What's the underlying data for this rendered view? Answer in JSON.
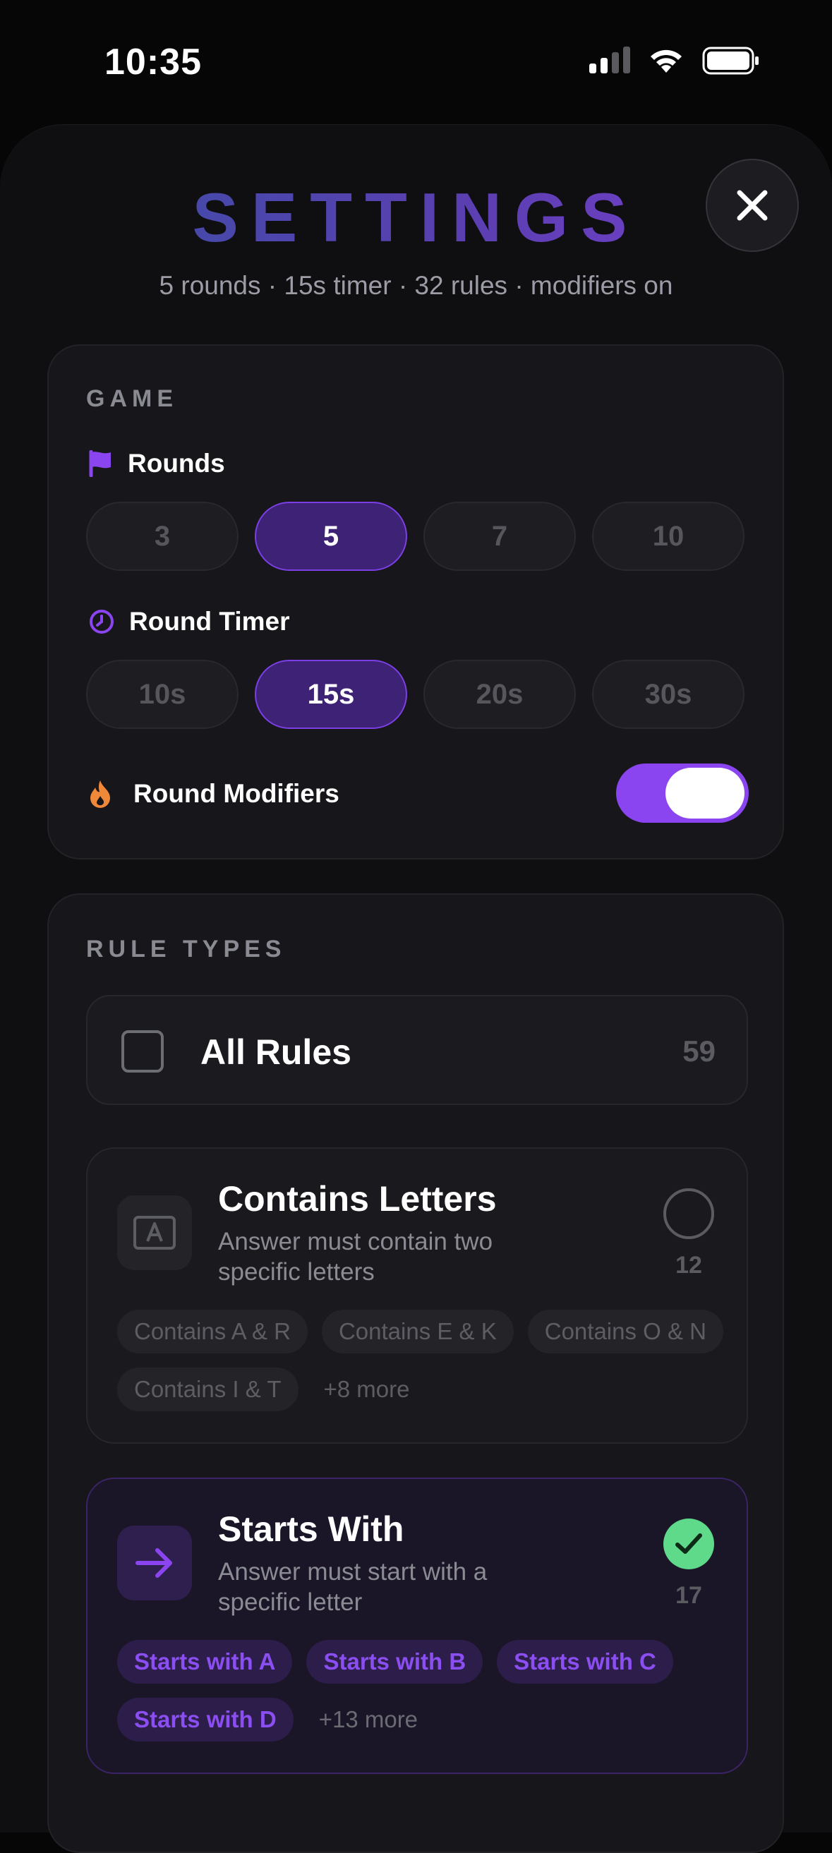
{
  "status": {
    "time": "10:35"
  },
  "header": {
    "title": "SETTINGS",
    "subtitle": "5 rounds · 15s timer · 32 rules · modifiers on"
  },
  "game": {
    "section_label": "GAME",
    "rounds": {
      "label": "Rounds",
      "options": [
        "3",
        "5",
        "7",
        "10"
      ],
      "selected": "5"
    },
    "timer": {
      "label": "Round Timer",
      "options": [
        "10s",
        "15s",
        "20s",
        "30s"
      ],
      "selected": "15s"
    },
    "modifiers": {
      "label": "Round Modifiers",
      "enabled": true
    }
  },
  "rule_types": {
    "section_label": "RULE TYPES",
    "all_rules": {
      "label": "All Rules",
      "count": "59",
      "checked": false
    },
    "rules": [
      {
        "title": "Contains Letters",
        "description": "Answer must contain two specific letters",
        "count": "12",
        "selected": false,
        "icon": "letter-a-icon",
        "chips": [
          "Contains A & R",
          "Contains E & K",
          "Contains O & N",
          "Contains I & T"
        ],
        "more": "+8 more"
      },
      {
        "title": "Starts With",
        "description": "Answer must start with a specific letter",
        "count": "17",
        "selected": true,
        "icon": "arrow-right-icon",
        "chips": [
          "Starts with A",
          "Starts with B",
          "Starts with C",
          "Starts with D"
        ],
        "more": "+13 more"
      }
    ]
  },
  "colors": {
    "accent": "#8a45f0",
    "check": "#5fd98a",
    "fire": "#f0883a"
  }
}
